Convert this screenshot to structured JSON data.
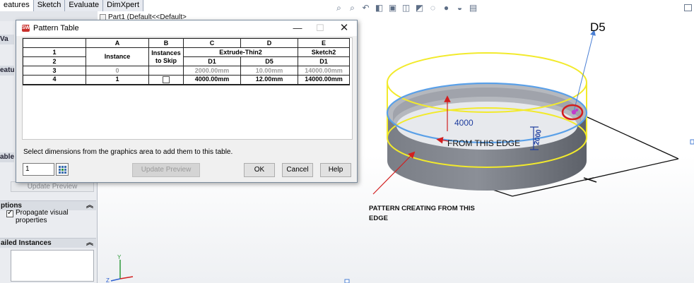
{
  "command_tabs": [
    "eatures",
    "Sketch",
    "Evaluate",
    "DimXpert"
  ],
  "tree": {
    "part_label": "Part1  (Default<<Default>"
  },
  "left_panel": {
    "fragments": [
      "Va",
      "eatur",
      "able"
    ],
    "update_preview_label": "Update Preview",
    "options_header": "ptions",
    "propagate_label": "Propagate visual properties",
    "propagate_checked": true,
    "instances_header": "ailed Instances"
  },
  "dialog": {
    "title": "Pattern Table",
    "minimize": "—",
    "maximize": "☐",
    "close": "✕",
    "columns": [
      "A",
      "B",
      "C",
      "D",
      "E"
    ],
    "header_row1": {
      "num": "1",
      "instance": "Instance",
      "skip": "Instances to Skip",
      "feature": "Extrude-Thin2",
      "sketch": "Sketch2"
    },
    "header_row2": {
      "num": "2",
      "c": "D1",
      "d": "D5",
      "e": "D1"
    },
    "rows": [
      {
        "num": "3",
        "instance": "0",
        "skip": "",
        "c": "2000.00mm",
        "d": "10.00mm",
        "e": "14000.00mm",
        "state": "seed"
      },
      {
        "num": "4",
        "instance": "1",
        "skip": "checkbox",
        "c": "4000.00mm",
        "d": "12.00mm",
        "e": "14000.00mm",
        "state": "editable"
      }
    ],
    "hint": "Select dimensions from the graphics area to add them to this table.",
    "count_value": "1",
    "update_preview_label": "Update Preview",
    "ok_label": "OK",
    "cancel_label": "Cancel",
    "help_label": "Help"
  },
  "annotations": {
    "d5_label": "D5",
    "dim_4000": "4000",
    "dim_2000": "2000",
    "from_edge": "FROM THIS EDGE",
    "pattern_line1": "PATTERN CREATING FROM THIS",
    "pattern_line2": "EDGE"
  },
  "colors": {
    "cylinder_fill": "#73777f",
    "pattern_preview": "#f2ea2c",
    "selected_edge": "#5aa0e8",
    "annotation_red": "#d21f1f",
    "d5_leader": "#4a7fd4",
    "selection_marker": "#c03ccf",
    "dimension_blue": "#1f3d9e"
  }
}
